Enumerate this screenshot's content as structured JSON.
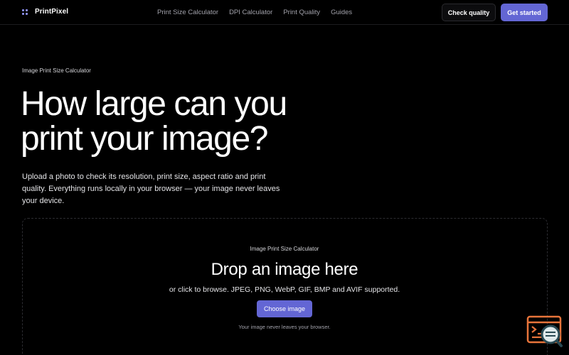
{
  "header": {
    "brand": "PrintPixel",
    "nav": [
      "Print Size Calculator",
      "DPI Calculator",
      "Print Quality",
      "Guides"
    ],
    "check_quality": "Check quality",
    "get_started": "Get started"
  },
  "hero": {
    "eyebrow": "Image Print Size Calculator",
    "title_line1": "How large can you",
    "title_line2": "print your image?",
    "subtitle": "Upload a photo to check its resolution, print size, aspect ratio and print quality. Everything runs locally in your browser — your image never leaves your device."
  },
  "dropzone": {
    "label": "Image Print Size Calculator",
    "title": "Drop an image here",
    "description": "or click to browse. JPEG, PNG, WebP, GIF, BMP and AVIF supported.",
    "button": "Choose image",
    "note": "Your image never leaves your browser."
  },
  "colors": {
    "accent": "#6366d4",
    "background": "#000000",
    "widget": "#e8743b"
  },
  "icons": {
    "logo": "grid-dots-icon",
    "widget": "console-search-icon"
  }
}
